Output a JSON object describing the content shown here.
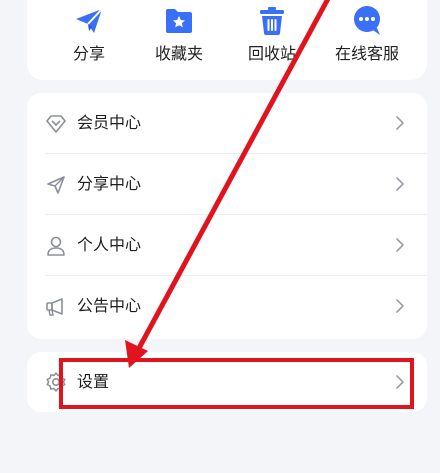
{
  "quick_actions": [
    {
      "label": "分享",
      "icon": "share-paper-plane-icon"
    },
    {
      "label": "收藏夹",
      "icon": "favorites-folder-icon"
    },
    {
      "label": "回收站",
      "icon": "recycle-bin-icon"
    },
    {
      "label": "在线客服",
      "icon": "online-service-chat-icon"
    }
  ],
  "menu": {
    "items": [
      {
        "label": "会员中心",
        "icon": "member-diamond-icon"
      },
      {
        "label": "分享中心",
        "icon": "share-plane-outline-icon"
      },
      {
        "label": "个人中心",
        "icon": "person-icon"
      },
      {
        "label": "公告中心",
        "icon": "megaphone-icon"
      }
    ]
  },
  "settings": {
    "label": "设置",
    "icon": "gear-icon"
  },
  "colors": {
    "accent": "#3a6ff7",
    "annotation": "#e0141e",
    "icon_gray": "#8a8f99"
  }
}
